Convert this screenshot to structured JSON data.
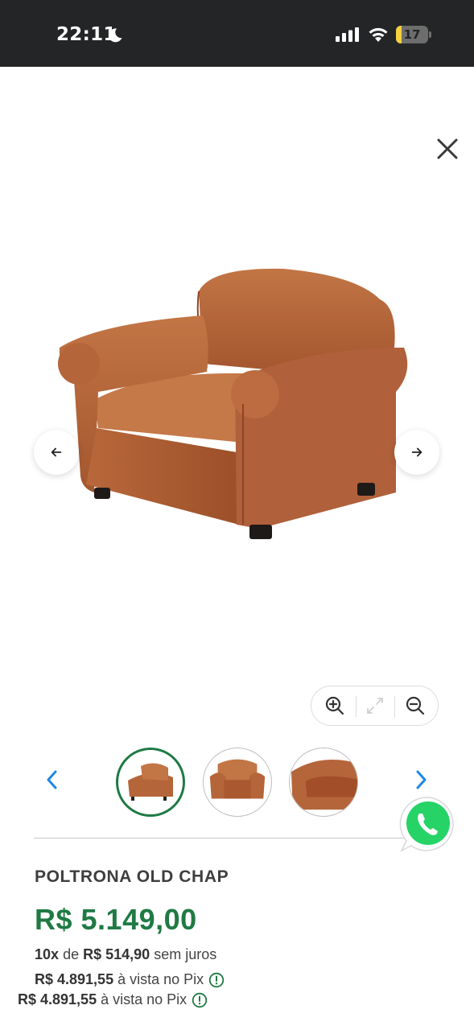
{
  "status_bar": {
    "time": "22:11",
    "battery": "17",
    "battery_level_percent": 17,
    "icons": [
      "moon-icon",
      "signal-icon",
      "wifi-icon",
      "battery-icon"
    ]
  },
  "gallery": {
    "close_icon": "close-icon",
    "prev_icon": "arrow-left-icon",
    "next_icon": "arrow-right-icon",
    "zoom_in_icon": "zoom-in-icon",
    "fullscreen_icon": "expand-icon",
    "zoom_out_icon": "zoom-out-icon",
    "thumbnails_count": 3,
    "active_thumbnail": 1,
    "thumb_prev_icon": "chevron-left-icon",
    "thumb_next_icon": "chevron-right-icon"
  },
  "colors": {
    "accent_green": "#1f7a44",
    "leather": "#b5653a",
    "whatsapp": "#25d366",
    "thumb_arrow": "#1e88e5"
  },
  "product": {
    "title": "POLTRONA OLD CHAP",
    "price": "R$ 5.149,00",
    "installments": {
      "count": "10x",
      "of": "de",
      "amount": "R$ 514,90",
      "suffix": "sem juros"
    },
    "pix": [
      {
        "amount": "R$ 4.891,55",
        "label": "à vista no Pix"
      },
      {
        "amount": "R$ 4.891,55",
        "label": "à vista no Pix"
      }
    ]
  }
}
